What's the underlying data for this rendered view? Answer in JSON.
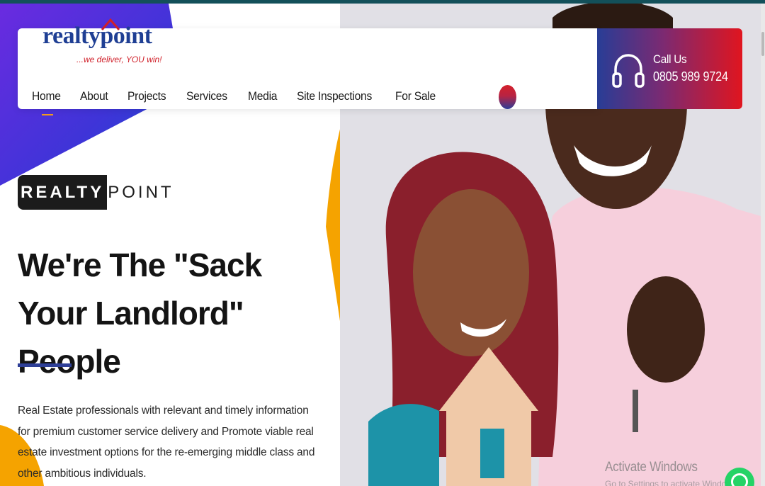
{
  "brand": {
    "logo_text": "realtypoint",
    "tagline": "...we deliver, YOU win!",
    "colors": {
      "primary_blue": "#2e3f97",
      "accent_red": "#e0151f",
      "accent_orange": "#f5a300",
      "purple": "#5b2bd6"
    }
  },
  "nav": {
    "items": [
      {
        "label": "Home"
      },
      {
        "label": "About"
      },
      {
        "label": "Projects"
      },
      {
        "label": "Services"
      },
      {
        "label": "Media"
      },
      {
        "label": "Site Inspections"
      },
      {
        "label": "For Sale"
      }
    ],
    "active": "Home",
    "search_icon": "search-icon"
  },
  "contact": {
    "label": "Call Us",
    "phone": "0805 989 9724",
    "icon": "headphones-icon"
  },
  "hero": {
    "badge_dark": "REALTY",
    "badge_light": "POINT",
    "headline": "We're The \"Sack Your Landlord\" People",
    "intro": "Real Estate professionals with relevant and timely information for premium customer service delivery and Promote viable real estate investment options for the re-emerging middle class and other ambitious individuals."
  },
  "system": {
    "watermark_title": "Activate Windows",
    "watermark_sub": "Go to Settings to activate Windows.",
    "chat_icon": "whatsapp-icon"
  }
}
